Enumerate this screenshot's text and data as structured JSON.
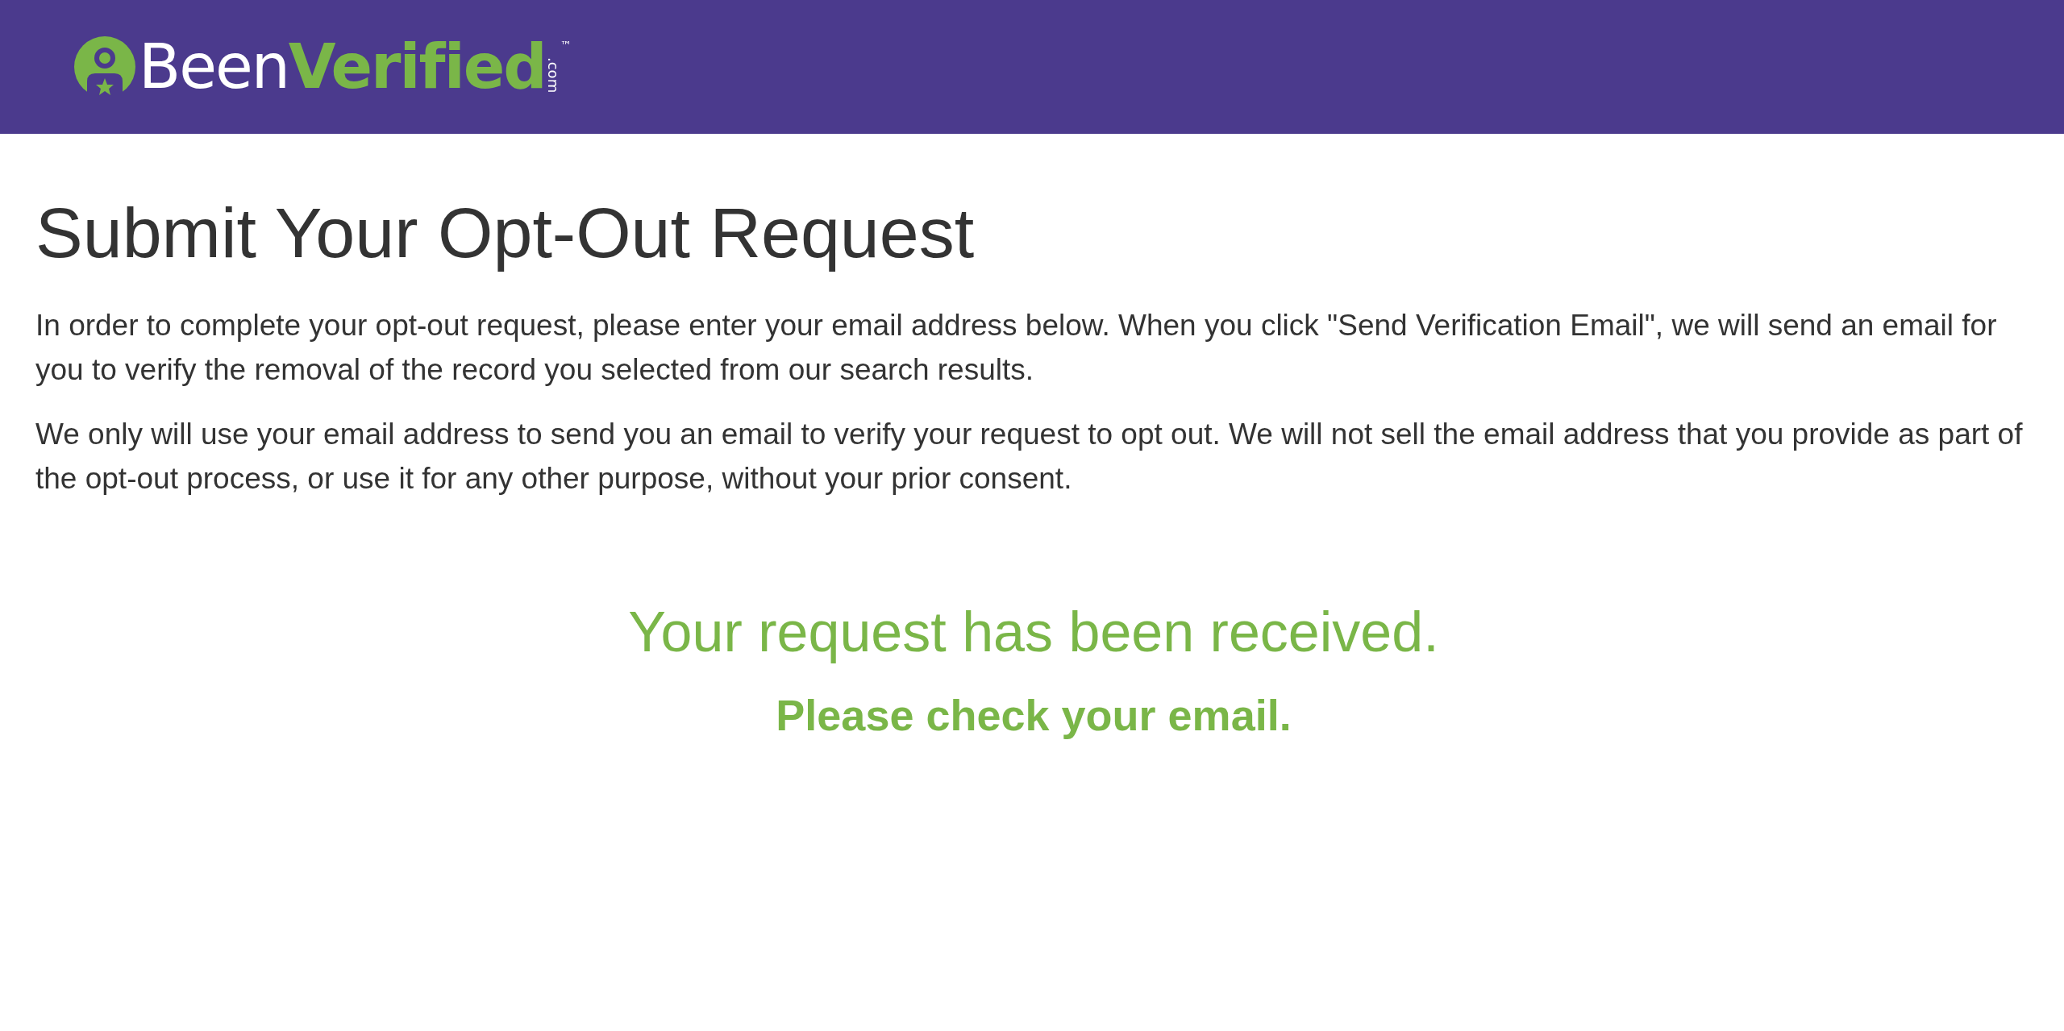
{
  "header": {
    "logo": {
      "word_1": "Been",
      "word_2": "Verified",
      "suffix": ".com",
      "trademark": "™"
    }
  },
  "title": "Submit Your Opt-Out Request",
  "paragraphs": [
    "In order to complete your opt-out request, please enter your email address below. When you click \"Send Verification Email\", we will send an email for you to verify the removal of the record you selected from our search results.",
    "We only will use your email address to send you an email to verify your request to opt out. We will not sell the email address that you provide as part of the opt-out process, or use it for any other purpose, without your prior consent."
  ],
  "confirmation": {
    "message": "Your request has been received.",
    "instruction": "Please check your email."
  }
}
